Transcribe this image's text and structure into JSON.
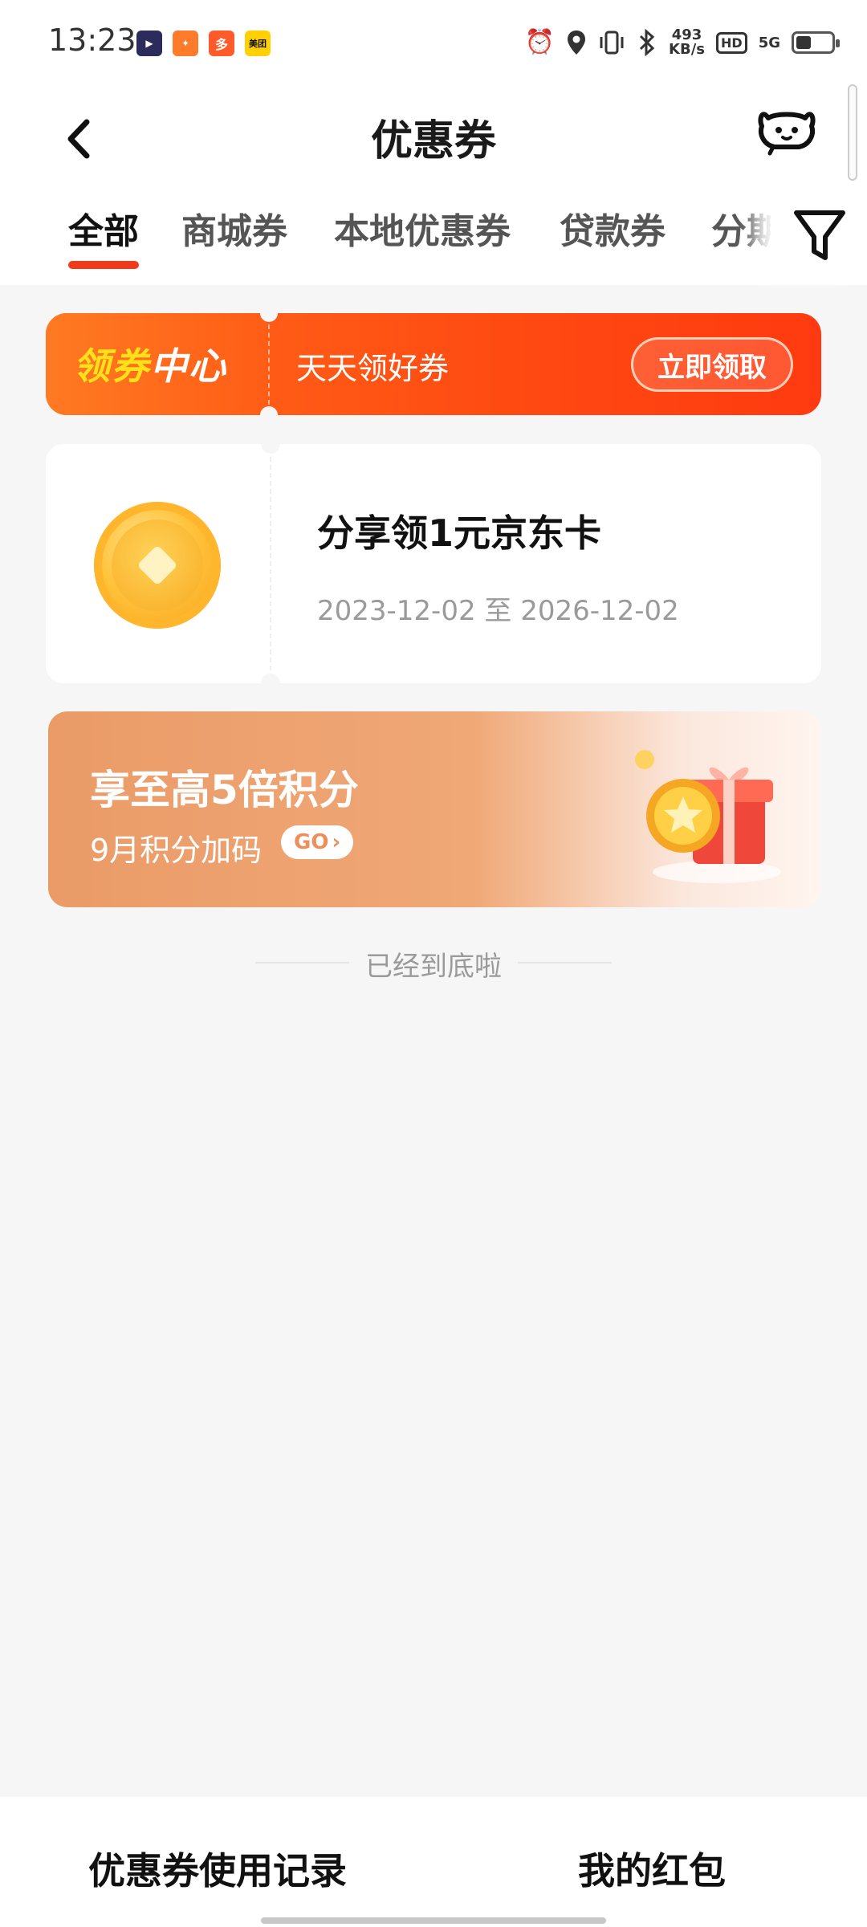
{
  "status_bar": {
    "time": "13:23",
    "apps": [
      {
        "icon": "video-app-icon",
        "color": "#2b2b5c",
        "glyph": "▶"
      },
      {
        "icon": "game-app-icon",
        "color": "#ff7b2c",
        "glyph": "✦"
      },
      {
        "icon": "shopping-app-icon",
        "color": "#ff5a2a",
        "glyph": "多"
      },
      {
        "icon": "meituan-app-icon",
        "color": "#ffd100",
        "glyph": "美团"
      }
    ],
    "net_speed_value": "493",
    "net_speed_unit": "KB/s",
    "hd_label": "HD",
    "signal_label": "5G"
  },
  "header": {
    "title": "优惠券"
  },
  "tabs": [
    {
      "label": "全部",
      "active": true
    },
    {
      "label": "商城券",
      "active": false
    },
    {
      "label": "本地优惠券",
      "active": false
    },
    {
      "label": "贷款券",
      "active": false
    },
    {
      "label": "分期",
      "active": false
    }
  ],
  "banner": {
    "title_highlight": "领券",
    "title_rest": "中心",
    "subtitle": "天天领好券",
    "button_label": "立即领取"
  },
  "coupon": {
    "title": "分享领1元京东卡",
    "date_range": "2023-12-02 至 2026-12-02"
  },
  "promo": {
    "title": "享至高5倍积分",
    "subtitle": "9月积分加码",
    "go_label": "GO"
  },
  "end_text": "已经到底啦",
  "bottom_bar": {
    "left_label": "优惠券使用记录",
    "right_label": "我的红包"
  },
  "colors": {
    "accent": "#f23a1b",
    "banner_orange": "#ff5d16",
    "highlight_yellow": "#ffe11a",
    "promo_orange": "#ea9b67"
  }
}
